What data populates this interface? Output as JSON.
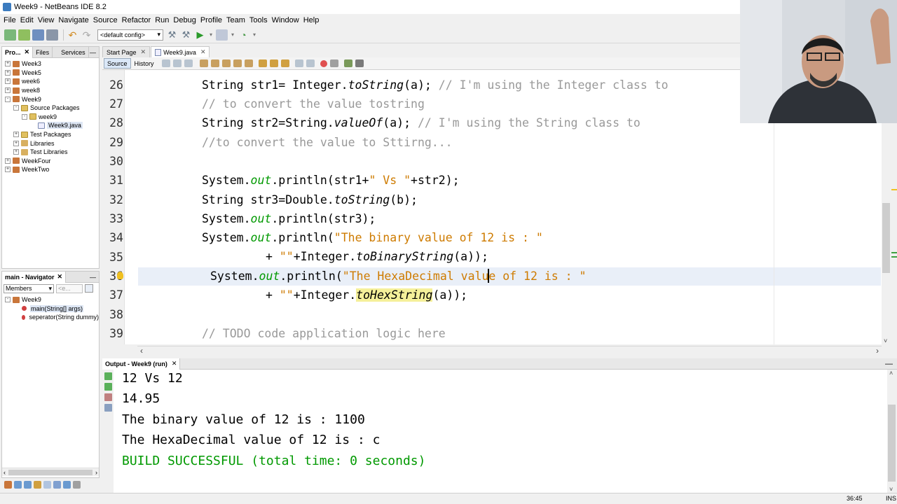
{
  "window": {
    "title": "Week9 - NetBeans IDE 8.2"
  },
  "menu": [
    "File",
    "Edit",
    "View",
    "Navigate",
    "Source",
    "Refactor",
    "Run",
    "Debug",
    "Profile",
    "Team",
    "Tools",
    "Window",
    "Help"
  ],
  "toolbar": {
    "config": "<default config>"
  },
  "projects": {
    "tabs": [
      "Pro...",
      "Files",
      "Services"
    ],
    "tree": [
      {
        "label": "Week3",
        "depth": 0,
        "type": "project",
        "exp": "+"
      },
      {
        "label": "Week5",
        "depth": 0,
        "type": "project",
        "exp": "+"
      },
      {
        "label": "week6",
        "depth": 0,
        "type": "project",
        "exp": "+"
      },
      {
        "label": "week8",
        "depth": 0,
        "type": "project",
        "exp": "+"
      },
      {
        "label": "Week9",
        "depth": 0,
        "type": "project",
        "exp": "-"
      },
      {
        "label": "Source Packages",
        "depth": 1,
        "type": "folder",
        "exp": "-"
      },
      {
        "label": "week9",
        "depth": 2,
        "type": "package",
        "exp": "-"
      },
      {
        "label": "Week9.java",
        "depth": 3,
        "type": "file",
        "exp": "",
        "selected": true
      },
      {
        "label": "Test Packages",
        "depth": 1,
        "type": "folder",
        "exp": "+"
      },
      {
        "label": "Libraries",
        "depth": 1,
        "type": "lib",
        "exp": "+"
      },
      {
        "label": "Test Libraries",
        "depth": 1,
        "type": "lib",
        "exp": "+"
      },
      {
        "label": "WeekFour",
        "depth": 0,
        "type": "project",
        "exp": "+"
      },
      {
        "label": "WeekTwo",
        "depth": 0,
        "type": "project",
        "exp": "+"
      }
    ]
  },
  "navigator": {
    "title": "main - Navigator",
    "filter": "Members",
    "search": "<e...",
    "root": "Week9",
    "members": [
      {
        "name": "main(String[] args)",
        "selected": true
      },
      {
        "name": "seperator(String dummy)",
        "selected": false
      }
    ]
  },
  "editor": {
    "tabs": [
      {
        "label": "Start Page",
        "active": false
      },
      {
        "label": "Week9.java",
        "active": true
      }
    ],
    "modes": [
      "Source",
      "History"
    ],
    "line_numbers": [
      "26",
      "27",
      "28",
      "29",
      "30",
      "31",
      "32",
      "33",
      "34",
      "35",
      "36",
      "37",
      "38",
      "39"
    ],
    "code": {
      "l26a": "String str1= Integer.",
      "l26b": "toString",
      "l26c": "(a); ",
      "l26d": "// I'm using the Integer class to",
      "l27": "// to convert the value tostring",
      "l28a": "String str2=String.",
      "l28b": "valueOf",
      "l28c": "(a); ",
      "l28d": "// I'm using the String class to",
      "l29": "//to convert the value to Sttirng...",
      "l31a": "System.",
      "l31b": "out",
      "l31c": ".println(str1+",
      "l31d": "\" Vs \"",
      "l31e": "+str2);",
      "l32a": "String str3=Double.",
      "l32b": "toString",
      "l32c": "(b);",
      "l33a": "System.",
      "l33b": "out",
      "l33c": ".println(str3);",
      "l34a": "System.",
      "l34b": "out",
      "l34c": ".println(",
      "l34d": "\"The binary value of 12 is : \"",
      "l35a": "+ ",
      "l35b": "\"\"",
      "l35c": "+Integer.",
      "l35d": "toBinaryString",
      "l35e": "(a));",
      "l36a": "System.",
      "l36b": "out",
      "l36c": ".println(",
      "l36d": "\"The HexaDecimal value of 12 is : \"",
      "l37a": "+ ",
      "l37b": "\"\"",
      "l37c": "+Integer.",
      "l37d": "toHexString",
      "l37e": "(a));",
      "l39": "// TODO code application logic here"
    }
  },
  "output": {
    "tab": "Output - Week9 (run)",
    "lines": [
      "12 Vs 12",
      "14.95",
      "The binary value of 12 is : 1100",
      "The HexaDecimal value of 12 is : c"
    ],
    "result": "BUILD SUCCESSFUL (total time: 0 seconds)"
  },
  "status": {
    "position": "36:45",
    "mode": "INS"
  },
  "colors": {
    "string": "#ce7b00",
    "comment": "#999999",
    "field": "#009900",
    "success": "#009900",
    "current_line": "#e9eff8"
  }
}
